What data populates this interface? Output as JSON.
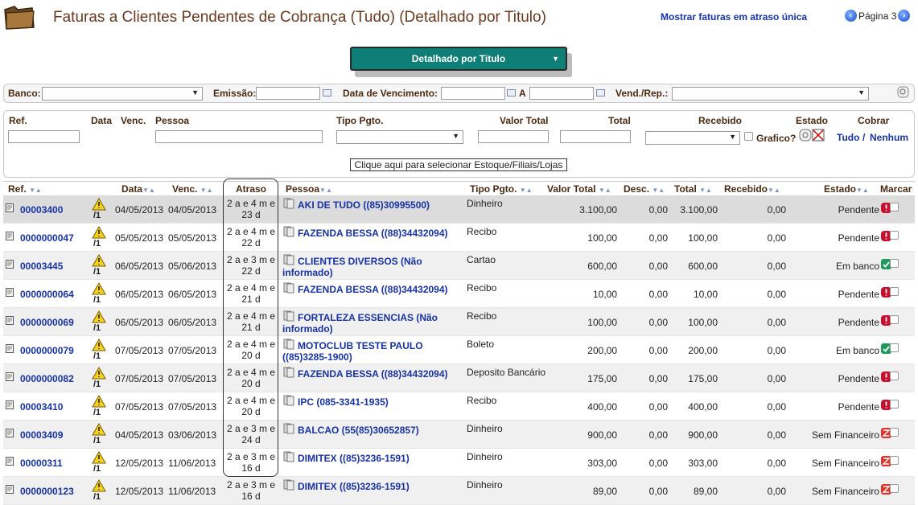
{
  "header": {
    "title": "Faturas a Clientes Pendentes de Cobrança (Tudo) (Detalhado por Titulo)",
    "late_link": "Mostrar faturas em atraso única",
    "page_label": "Página 3"
  },
  "mode_select": {
    "value": "Detalhado por Titulo"
  },
  "filters": {
    "banco": "Banco:",
    "emissao": "Emissão:",
    "vencimento": "Data de Vencimento:",
    "a": "A",
    "vend": "Vend./Rep.:"
  },
  "filter2": {
    "ref": "Ref.",
    "data": "Data",
    "venc": "Venc.",
    "pessoa": "Pessoa",
    "tipo": "Tipo Pgto.",
    "valor_total": "Valor Total",
    "total": "Total",
    "recebido": "Recebido",
    "estado": "Estado",
    "cobrar": "Cobrar",
    "grafico": "Grafico?",
    "tudo": "Tudo",
    "slash": "/",
    "nenhum": "Nenhum",
    "stock_button": "Clique aqui para selecionar Estoque/Filiais/Lojas"
  },
  "columns": {
    "ref": "Ref.",
    "data": "Data",
    "venc": "Venc.",
    "atraso": "Atraso",
    "pessoa": "Pessoa",
    "tipo": "Tipo Pgto.",
    "valor_total": "Valor Total",
    "desc": "Desc.",
    "total": "Total",
    "recebido": "Recebido",
    "estado": "Estado",
    "marcar": "Marcar"
  },
  "rows": [
    {
      "ref": "00003400",
      "warn": "/1",
      "data": "04/05/2013",
      "venc": "04/05/2013",
      "atraso1": "2 a e 4 m e",
      "atraso2": "23 d",
      "pessoa": "AKI DE TUDO ((85)30995500)",
      "tipo": "Dinheiro",
      "valor": "3.100,00",
      "desc": "0,00",
      "total": "3.100,00",
      "recebido": "0,00",
      "estado": "Pendente",
      "status": "red"
    },
    {
      "ref": "0000000047",
      "warn": "/1",
      "data": "05/05/2013",
      "venc": "05/05/2013",
      "atraso1": "2 a e 4 m e",
      "atraso2": "22 d",
      "pessoa": "FAZENDA BESSA ((88)34432094)",
      "tipo": "Recibo",
      "valor": "100,00",
      "desc": "0,00",
      "total": "100,00",
      "recebido": "0,00",
      "estado": "Pendente",
      "status": "red"
    },
    {
      "ref": "00003445",
      "warn": "/1",
      "data": "06/05/2013",
      "venc": "05/06/2013",
      "atraso1": "2 a e 3 m e",
      "atraso2": "22 d",
      "pessoa": "CLIENTES DIVERSOS (Não informado)",
      "tipo": "Cartao",
      "valor": "600,00",
      "desc": "0,00",
      "total": "600,00",
      "recebido": "0,00",
      "estado": "Em banco",
      "status": "green"
    },
    {
      "ref": "0000000064",
      "warn": "/1",
      "data": "06/05/2013",
      "venc": "06/05/2013",
      "atraso1": "2 a e 4 m e",
      "atraso2": "21 d",
      "pessoa": "FAZENDA BESSA ((88)34432094)",
      "tipo": "Recibo",
      "valor": "10,00",
      "desc": "0,00",
      "total": "10,00",
      "recebido": "0,00",
      "estado": "Pendente",
      "status": "red"
    },
    {
      "ref": "0000000069",
      "warn": "/1",
      "data": "06/05/2013",
      "venc": "06/05/2013",
      "atraso1": "2 a e 4 m e",
      "atraso2": "21 d",
      "pessoa": "FORTALEZA ESSENCIAS (Não informado)",
      "tipo": "Recibo",
      "valor": "100,00",
      "desc": "0,00",
      "total": "100,00",
      "recebido": "0,00",
      "estado": "Pendente",
      "status": "red"
    },
    {
      "ref": "0000000079",
      "warn": "/1",
      "data": "07/05/2013",
      "venc": "07/05/2013",
      "atraso1": "2 a e 4 m e",
      "atraso2": "20 d",
      "pessoa": "MOTOCLUB TESTE PAULO ((85)3285-1900)",
      "tipo": "Boleto",
      "valor": "200,00",
      "desc": "0,00",
      "total": "200,00",
      "recebido": "0,00",
      "estado": "Em banco",
      "status": "green"
    },
    {
      "ref": "0000000082",
      "warn": "/1",
      "data": "07/05/2013",
      "venc": "07/05/2013",
      "atraso1": "2 a e 4 m e",
      "atraso2": "20 d",
      "pessoa": "FAZENDA BESSA ((88)34432094)",
      "tipo": "Deposito Bancário",
      "valor": "175,00",
      "desc": "0,00",
      "total": "175,00",
      "recebido": "0,00",
      "estado": "Pendente",
      "status": "red"
    },
    {
      "ref": "00003410",
      "warn": "/1",
      "data": "07/05/2013",
      "venc": "07/05/2013",
      "atraso1": "2 a e 4 m e",
      "atraso2": "20 d",
      "pessoa": "IPC (085-3341-1935)",
      "tipo": "Recibo",
      "valor": "400,00",
      "desc": "0,00",
      "total": "400,00",
      "recebido": "0,00",
      "estado": "Pendente",
      "status": "red"
    },
    {
      "ref": "00003409",
      "warn": "/1",
      "data": "04/05/2013",
      "venc": "03/06/2013",
      "atraso1": "2 a e 3 m e",
      "atraso2": "24 d",
      "pessoa": "BALCAO (55(85)30652857)",
      "tipo": "Dinheiro",
      "valor": "900,00",
      "desc": "0,00",
      "total": "900,00",
      "recebido": "0,00",
      "estado": "Sem Financeiro",
      "status": "x"
    },
    {
      "ref": "00000311",
      "warn": "/1",
      "data": "12/05/2013",
      "venc": "11/06/2013",
      "atraso1": "2 a e 3 m e",
      "atraso2": "16 d",
      "pessoa": "DIMITEX ((85)3236-1591)",
      "tipo": "Dinheiro",
      "valor": "303,00",
      "desc": "0,00",
      "total": "303,00",
      "recebido": "0,00",
      "estado": "Sem Financeiro",
      "status": "x"
    },
    {
      "ref": "0000000123",
      "warn": "/1",
      "data": "12/05/2013",
      "venc": "11/06/2013",
      "atraso1": "2 a e 3 m e",
      "atraso2": "16 d",
      "pessoa": "DIMITEX ((85)3236-1591)",
      "tipo": "Dinheiro",
      "valor": "89,00",
      "desc": "0,00",
      "total": "89,00",
      "recebido": "0,00",
      "estado": "Sem Financeiro",
      "status": "x"
    }
  ],
  "colors": {
    "title": "#6b3a1e",
    "link": "#1733a6",
    "accent": "#0f7e77",
    "pending": "#c8102e",
    "bank": "#1e9a5a"
  }
}
